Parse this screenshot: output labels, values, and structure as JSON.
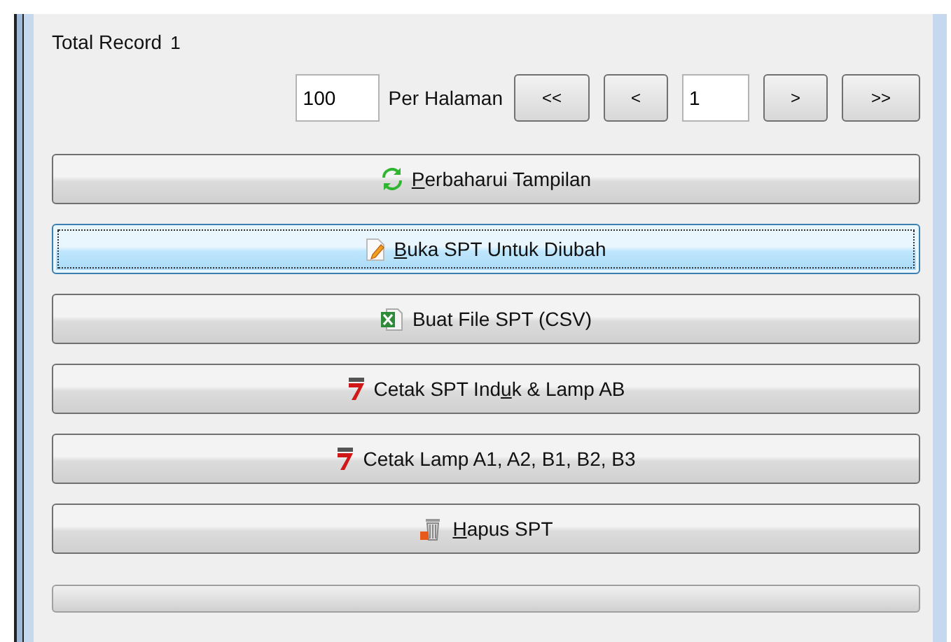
{
  "total_record": {
    "label": "Total Record",
    "value": "1"
  },
  "pagination": {
    "page_size": "100",
    "page_size_label": "Per Halaman",
    "first": "<<",
    "prev": "<",
    "page": "1",
    "next": ">",
    "last": ">>"
  },
  "actions": [
    {
      "kind": "refresh",
      "label_parts": [
        {
          "text": "P",
          "underlined": true
        },
        {
          "text": "erbaharui Tampilan",
          "underlined": false
        }
      ],
      "focused": false
    },
    {
      "kind": "edit",
      "label_parts": [
        {
          "text": "B",
          "underlined": true
        },
        {
          "text": "uka SPT Untuk Diubah",
          "underlined": false
        }
      ],
      "focused": true
    },
    {
      "kind": "excel",
      "label_parts": [
        {
          "text": "Buat File SPT (CSV)",
          "underlined": false
        }
      ],
      "focused": false
    },
    {
      "kind": "pdf",
      "label_parts": [
        {
          "text": "Cetak SPT Ind",
          "underlined": false
        },
        {
          "text": "u",
          "underlined": true
        },
        {
          "text": "k & Lamp AB",
          "underlined": false
        }
      ],
      "focused": false
    },
    {
      "kind": "pdf",
      "label_parts": [
        {
          "text": "Cetak Lamp A1, A2, B1, B2, B3",
          "underlined": false
        }
      ],
      "focused": false
    },
    {
      "kind": "trash",
      "label_parts": [
        {
          "text": "H",
          "underlined": true
        },
        {
          "text": "apus SPT",
          "underlined": false
        }
      ],
      "focused": false
    }
  ],
  "progress": {
    "level": 0
  }
}
